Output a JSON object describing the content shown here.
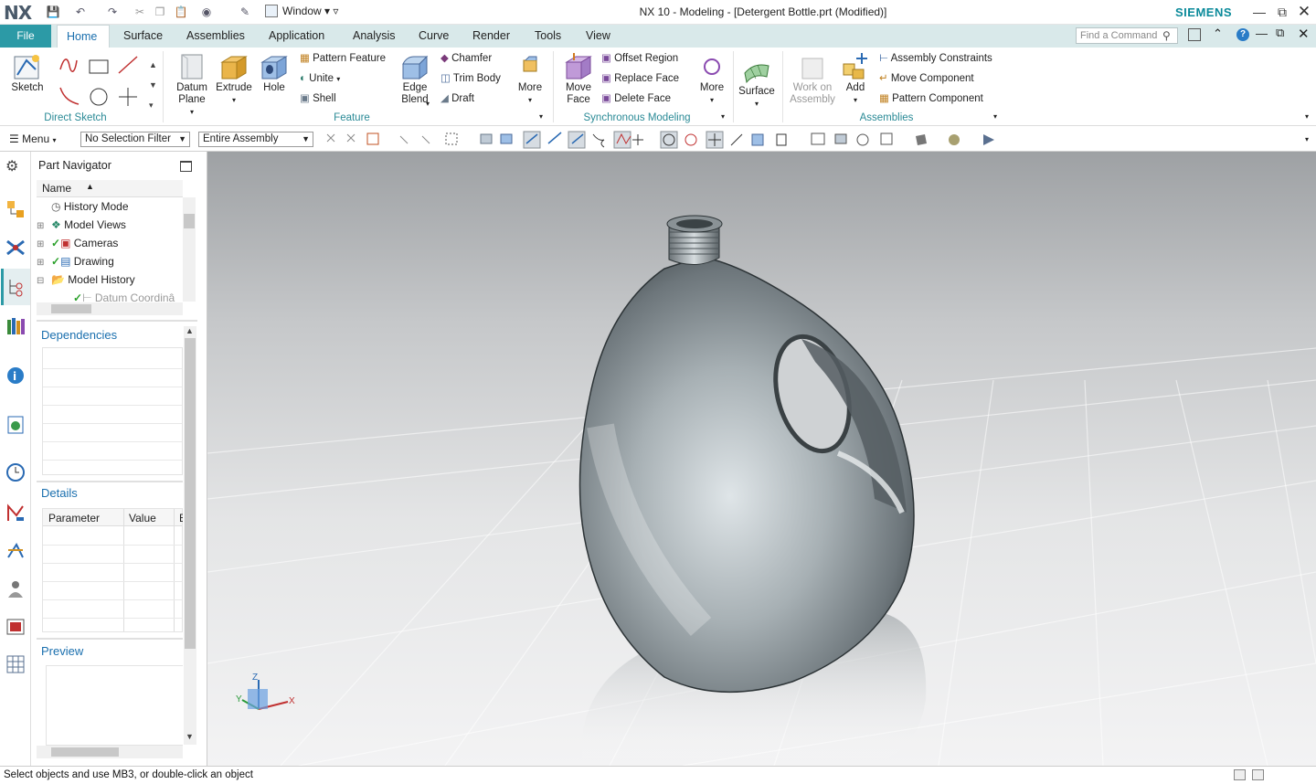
{
  "app": {
    "logo": "NX",
    "window_title": "NX 10 - Modeling - [Detergent Bottle.prt (Modified)]",
    "brand": "SIEMENS",
    "window_menu": "Window"
  },
  "tabs": {
    "file": "File",
    "items": [
      "Home",
      "Surface",
      "Assemblies",
      "Application",
      "Analysis",
      "Curve",
      "Render",
      "Tools",
      "View"
    ],
    "active": "Home"
  },
  "find_command": {
    "placeholder": "Find a Command"
  },
  "ribbon": {
    "direct_sketch": {
      "label": "Direct Sketch",
      "sketch": "Sketch"
    },
    "feature": {
      "label": "Feature",
      "datum_plane": "Datum Plane",
      "extrude": "Extrude",
      "hole": "Hole",
      "pattern_feature": "Pattern Feature",
      "unite": "Unite",
      "shell": "Shell",
      "edge_blend": "Edge Blend",
      "chamfer": "Chamfer",
      "trim_body": "Trim Body",
      "draft": "Draft",
      "more": "More"
    },
    "sync": {
      "label": "Synchronous Modeling",
      "move_face": "Move Face",
      "offset_region": "Offset Region",
      "replace_face": "Replace Face",
      "delete_face": "Delete Face",
      "more": "More"
    },
    "surface": "Surface",
    "assemblies": {
      "label": "Assemblies",
      "work_on_assembly": "Work on Assembly",
      "add": "Add",
      "assembly_constraints": "Assembly Constraints",
      "move_component": "Move Component",
      "pattern_component": "Pattern Component"
    }
  },
  "toolbar": {
    "menu": "Menu",
    "selection_filter": "No Selection Filter",
    "scope": "Entire Assembly"
  },
  "navigator": {
    "title": "Part Navigator",
    "column_name": "Name",
    "rows": [
      "History Mode",
      "Model Views",
      "Cameras",
      "Drawing",
      "Model History",
      "Datum Coordinâ"
    ],
    "dependencies": "Dependencies",
    "details": "Details",
    "details_columns": [
      "Parameter",
      "Value",
      "E"
    ],
    "preview": "Preview"
  },
  "triad": {
    "x": "X",
    "y": "Y",
    "z": "Z"
  },
  "status": {
    "message": "Select objects and use MB3, or double-click an object"
  },
  "colors": {
    "accent": "#2c9aa6",
    "tabbar": "#d9e9ea",
    "link": "#1a6fae"
  }
}
